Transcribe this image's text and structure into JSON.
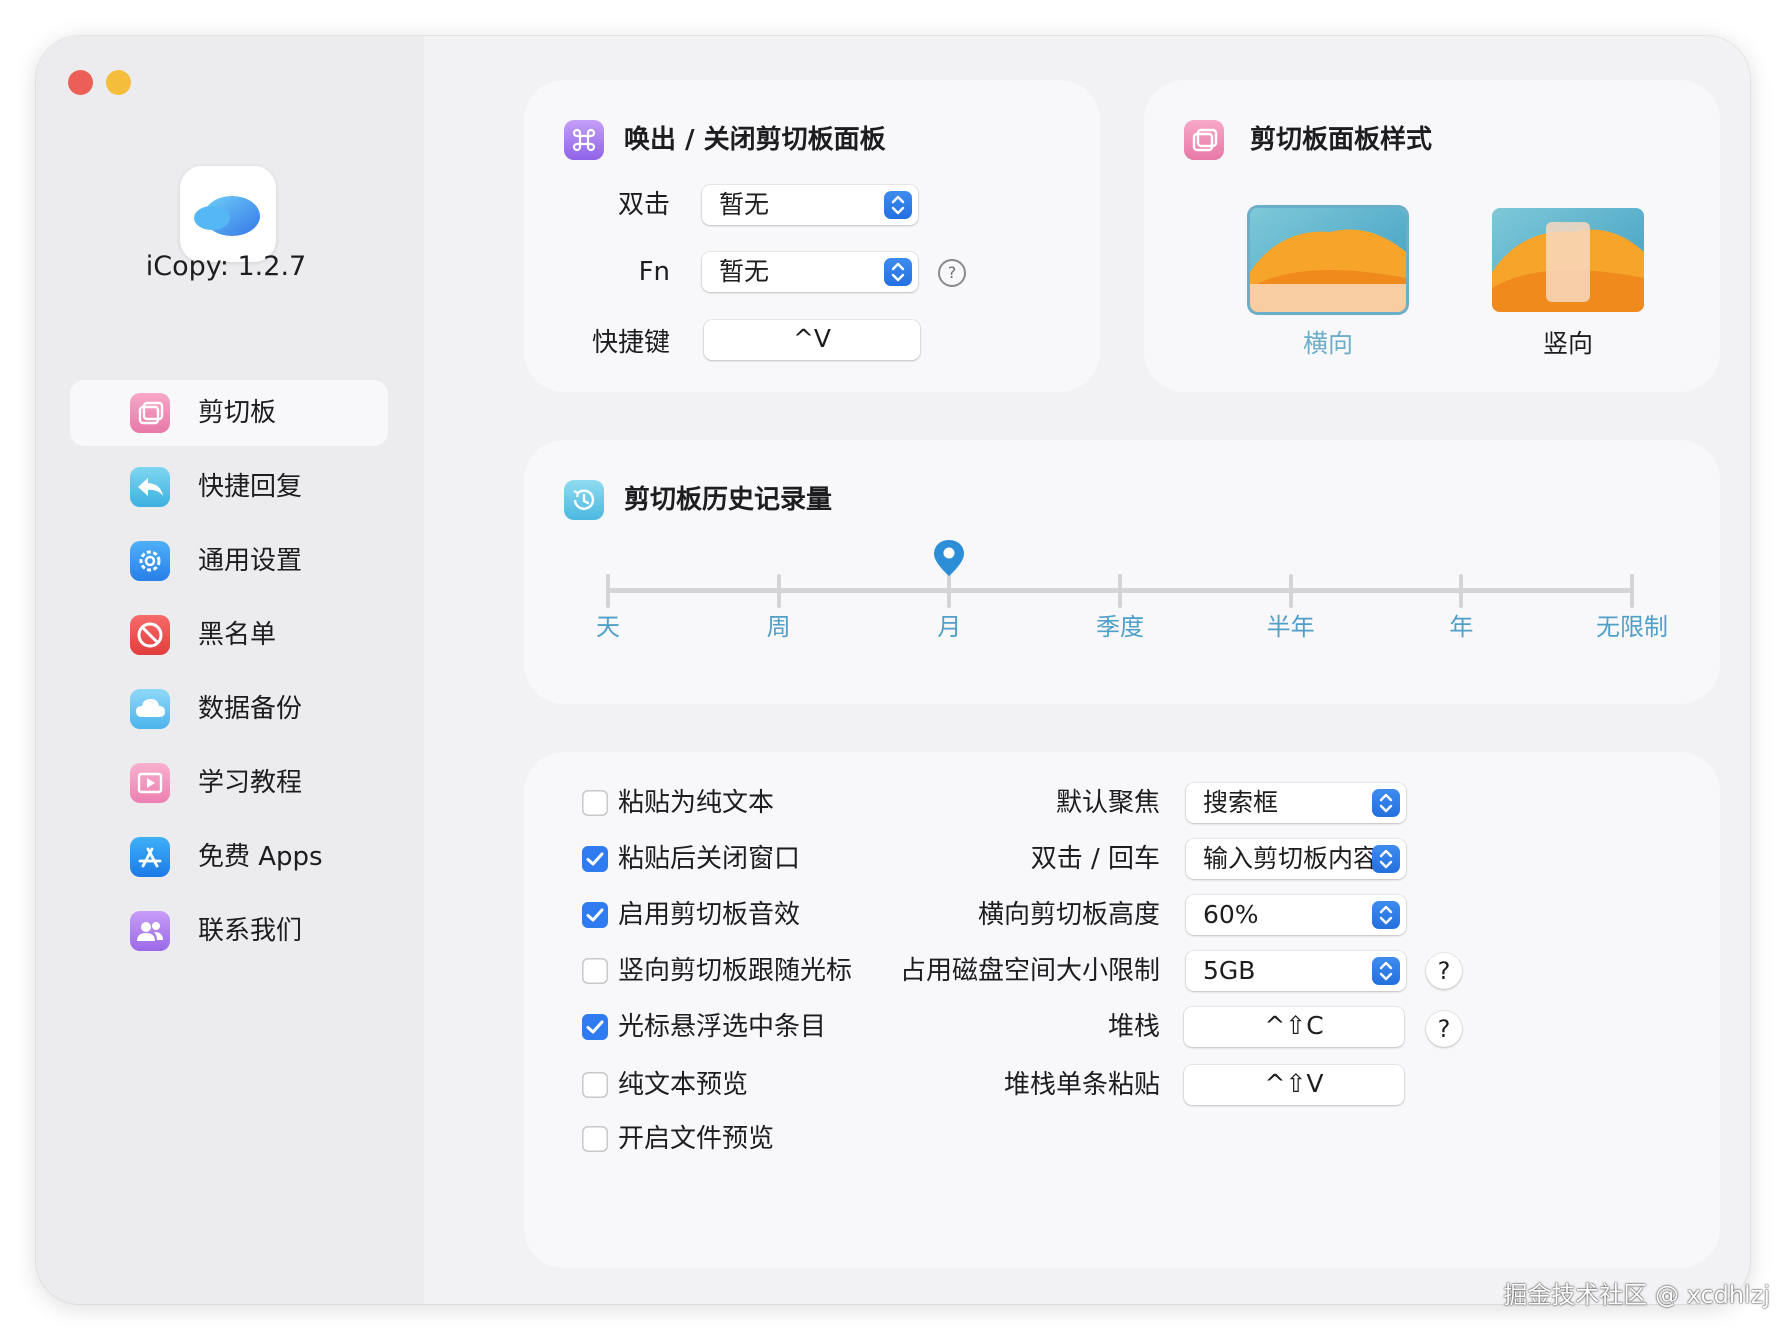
{
  "app": {
    "version_label": "iCopy: 1.2.7"
  },
  "sidebar": {
    "items": [
      {
        "label": "剪切板",
        "icon": "clipboard-icon",
        "active": true
      },
      {
        "label": "快捷回复",
        "icon": "reply-icon"
      },
      {
        "label": "通用设置",
        "icon": "gear-icon"
      },
      {
        "label": "黑名单",
        "icon": "block-icon"
      },
      {
        "label": "数据备份",
        "icon": "cloud-icon"
      },
      {
        "label": "学习教程",
        "icon": "video-icon"
      },
      {
        "label": "免费 Apps",
        "icon": "app-store-icon"
      },
      {
        "label": "联系我们",
        "icon": "contacts-icon"
      }
    ]
  },
  "toggle_panel": {
    "title": "唤出 / 关闭剪切板面板",
    "double_click_label": "双击",
    "double_click_value": "暂无",
    "fn_label": "Fn",
    "fn_value": "暂无",
    "help": "?",
    "shortcut_label": "快捷键",
    "shortcut_value": "^V"
  },
  "panel_style": {
    "title": "剪切板面板样式",
    "horizontal_label": "横向",
    "vertical_label": "竖向",
    "selected": "横向"
  },
  "history": {
    "title": "剪切板历史记录量",
    "ticks": [
      "天",
      "周",
      "月",
      "季度",
      "半年",
      "年",
      "无限制"
    ],
    "selected": "月",
    "selected_index": 2
  },
  "options": {
    "checkboxes": [
      {
        "label": "粘贴为纯文本",
        "checked": false
      },
      {
        "label": "粘贴后关闭窗口",
        "checked": true
      },
      {
        "label": "启用剪切板音效",
        "checked": true
      },
      {
        "label": "竖向剪切板跟随光标",
        "checked": false
      },
      {
        "label": "光标悬浮选中条目",
        "checked": true
      },
      {
        "label": "纯文本预览",
        "checked": false
      },
      {
        "label": "开启文件预览",
        "checked": false
      }
    ],
    "default_focus_label": "默认聚焦",
    "default_focus_value": "搜索框",
    "dblclick_enter_label": "双击 / 回车",
    "dblclick_enter_value": "输入剪切板内容",
    "horizontal_height_label": "横向剪切板高度",
    "horizontal_height_value": "60%",
    "disk_limit_label": "占用磁盘空间大小限制",
    "disk_limit_value": "5GB",
    "stack_label": "堆栈",
    "stack_value": "^⇧C",
    "stack_single_label": "堆栈单条粘贴",
    "stack_single_value": "^⇧V",
    "help": "?"
  },
  "watermark": "掘金技术社区 @ xcdhlzj",
  "colors": {
    "accent": "#2f7bf0",
    "slider_label": "#4f9fc8",
    "selected_style": "#6aaec9"
  }
}
